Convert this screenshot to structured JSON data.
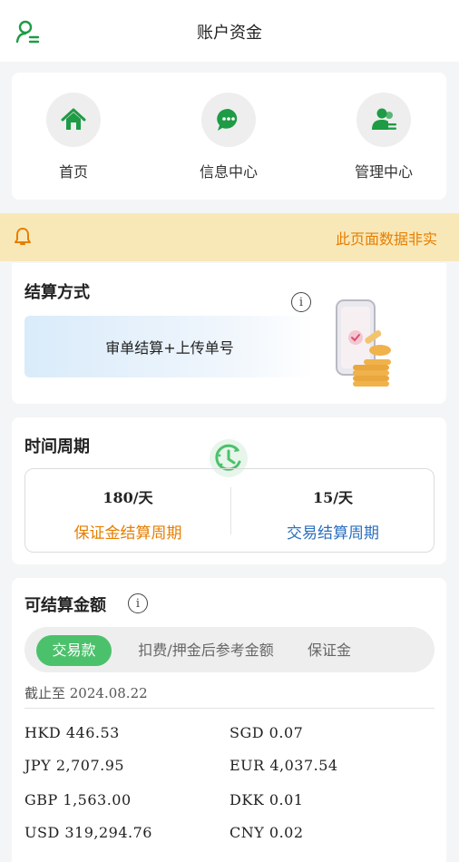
{
  "header": {
    "title": "账户资金",
    "user_icon": "user-menu-icon"
  },
  "nav": [
    {
      "label": "首页",
      "icon": "home-icon"
    },
    {
      "label": "信息中心",
      "icon": "message-icon"
    },
    {
      "label": "管理中心",
      "icon": "users-manage-icon"
    }
  ],
  "notice": {
    "text": "此页面数据非实",
    "icon": "bell-icon"
  },
  "settlement": {
    "title": "结算方式",
    "method": "审单结算+上传单号"
  },
  "period": {
    "title": "时间周期",
    "deposit": {
      "value": "180/天",
      "label": "保证金结算周期"
    },
    "trade": {
      "value": "15/天",
      "label": "交易结算周期"
    }
  },
  "amount": {
    "title": "可结算金额",
    "tabs": [
      "交易款",
      "扣费/押金后参考金额",
      "保证金"
    ],
    "active_tab": "交易款",
    "as_of": "截止至 2024.08.22",
    "currencies": [
      {
        "code": "HKD",
        "value": "446.53"
      },
      {
        "code": "SGD",
        "value": "0.07"
      },
      {
        "code": "JPY",
        "value": "2,707.95"
      },
      {
        "code": "EUR",
        "value": "4,037.54"
      },
      {
        "code": "GBP",
        "value": "1,563.00"
      },
      {
        "code": "DKK",
        "value": "0.01"
      },
      {
        "code": "USD",
        "value": "319,294.76"
      },
      {
        "code": "CNY",
        "value": "0.02"
      }
    ]
  },
  "colors": {
    "primary": "#1e9b45",
    "accent_green": "#4cc16b",
    "orange": "#e67e00",
    "blue": "#2a6fbf",
    "notice_bg": "#f8e8b8"
  }
}
